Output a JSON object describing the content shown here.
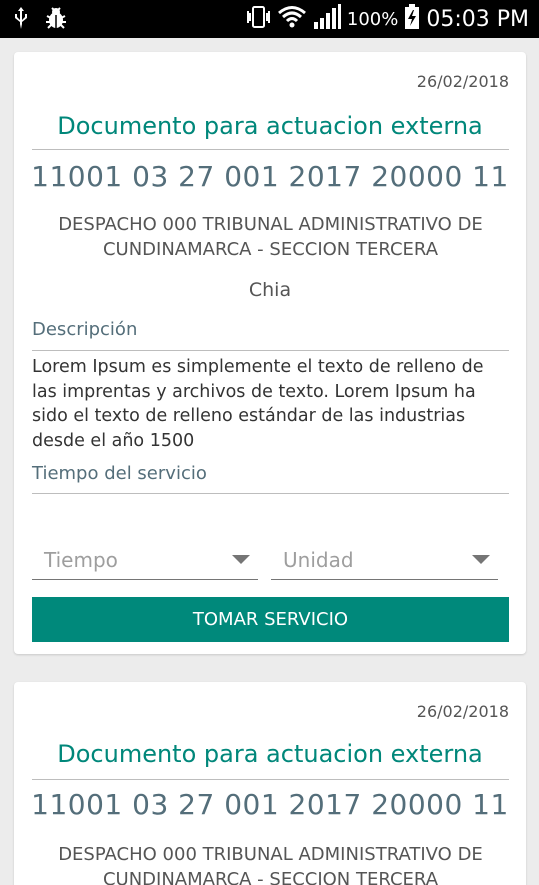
{
  "status_bar": {
    "icons": [
      "usb-icon",
      "debug-bug-icon",
      "vibrate-icon",
      "wifi-icon",
      "signal-icon",
      "battery-charging-icon"
    ],
    "battery_percent": "100%",
    "time": "05:03 PM"
  },
  "cards": [
    {
      "date": "26/02/2018",
      "title": "Documento para actuacion externa",
      "number": "11001 03 27 001 2017 20000 11",
      "office_line1": "DESPACHO 000 TRIBUNAL ADMINISTRATIVO DE",
      "office_line2": "CUNDINAMARCA - SECCION TERCERA",
      "city": "Chia",
      "description_label": "Descripción",
      "description_lines": [
        "Lorem Ipsum es simplemente el texto de relleno de",
        "las imprentas y archivos de texto. Lorem Ipsum ha",
        "sido el texto de relleno estándar de las industrias",
        "desde el año 1500"
      ],
      "service_time_label": "Tiempo del servicio",
      "time_select_placeholder": "Tiempo",
      "unit_select_placeholder": "Unidad",
      "button_label": "TOMAR SERVICIO"
    },
    {
      "date": "26/02/2018",
      "title": "Documento para actuacion externa",
      "number": "11001 03 27 001 2017 20000 11",
      "office_line1": "DESPACHO 000 TRIBUNAL ADMINISTRATIVO DE",
      "office_line2": "CUNDINAMARCA - SECCION TERCERA"
    }
  ],
  "colors": {
    "accent": "#00877a",
    "button": "#00897b",
    "number": "#546e7a"
  }
}
